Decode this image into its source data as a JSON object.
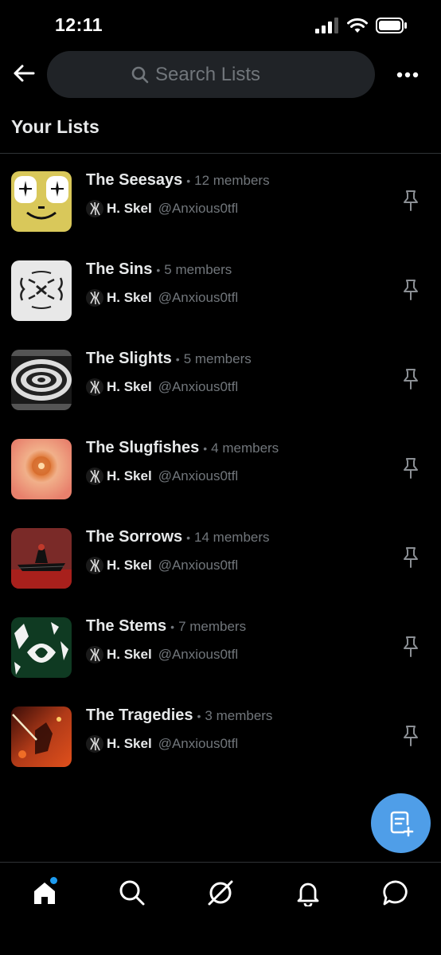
{
  "status_bar": {
    "time": "12:11"
  },
  "header": {
    "search_placeholder": "Search Lists"
  },
  "section": {
    "title": "Your Lists"
  },
  "lists": [
    {
      "name": "The Seesays",
      "members": "12 members",
      "owner_name": "H. Skel",
      "owner_handle": "@Anxious0tfl",
      "thumb": "seesays"
    },
    {
      "name": "The Sins",
      "members": "5 members",
      "owner_name": "H. Skel",
      "owner_handle": "@Anxious0tfl",
      "thumb": "sins"
    },
    {
      "name": "The Slights",
      "members": "5 members",
      "owner_name": "H. Skel",
      "owner_handle": "@Anxious0tfl",
      "thumb": "slights"
    },
    {
      "name": "The Slugfishes",
      "members": "4 members",
      "owner_name": "H. Skel",
      "owner_handle": "@Anxious0tfl",
      "thumb": "slugfishes"
    },
    {
      "name": "The Sorrows",
      "members": "14 members",
      "owner_name": "H. Skel",
      "owner_handle": "@Anxious0tfl",
      "thumb": "sorrows"
    },
    {
      "name": "The Stems",
      "members": "7 members",
      "owner_name": "H. Skel",
      "owner_handle": "@Anxious0tfl",
      "thumb": "stems"
    },
    {
      "name": "The Tragedies",
      "members": "3 members",
      "owner_name": "H. Skel",
      "owner_handle": "@Anxious0tfl",
      "thumb": "tragedies"
    }
  ],
  "nav": {
    "items": [
      "home-icon",
      "search-icon",
      "spaces-icon",
      "bell-icon",
      "messages-icon"
    ],
    "active": "home-icon"
  },
  "colors": {
    "background": "#000000",
    "accent": "#1d9bf0",
    "fab": "#4f9ee8",
    "muted_text": "#71767b",
    "search_bg": "#202327"
  }
}
